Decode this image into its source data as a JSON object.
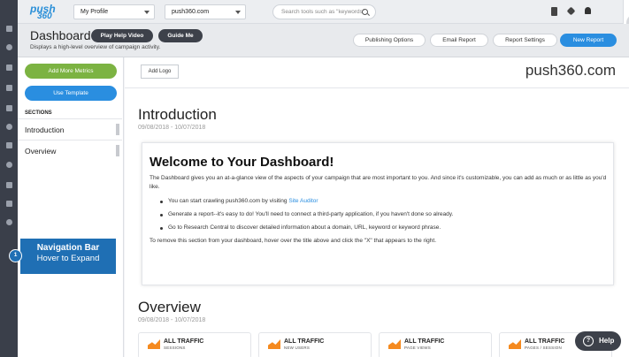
{
  "brand": {
    "logo_top": "push",
    "logo_bottom": "360"
  },
  "topbar": {
    "profile_select": "My Profile",
    "domain_select": "push360.com",
    "search_placeholder": "Search tools such as \"keywords\""
  },
  "header": {
    "title": "Dashboard",
    "subtitle": "Displays a high-level overview of campaign activity.",
    "play_help_video": "Play Help Video",
    "guide_me": "Guide Me",
    "publishing_options": "Publishing Options",
    "email_report": "Email Report",
    "report_settings": "Report Settings",
    "new_report": "New Report"
  },
  "sidebar": {
    "add_more_metrics": "Add More Metrics",
    "use_template": "Use Template",
    "sections_heading": "SECTIONS",
    "sections": [
      "Introduction",
      "Overview"
    ]
  },
  "callout": {
    "line1": "Navigation Bar",
    "line2": "Hover to Expand",
    "step_number": "1"
  },
  "main": {
    "add_logo": "Add Logo",
    "brand_name": "push360.com",
    "introduction": {
      "heading": "Introduction",
      "date_range": "09/08/2018 - 10/07/2018",
      "card_title": "Welcome to Your Dashboard!",
      "intro_text": "The Dashboard gives you an at-a-glance view of the aspects of your campaign that are most important to you. And since it's customizable, you can add as much or as little as you'd like.",
      "bullets": [
        {
          "text": "You can start crawling push360.com by visiting ",
          "link": "Site Auditor"
        },
        {
          "text": "Generate a report--it's easy to do! You'll need to connect a third-party application, if you haven't done so already.",
          "link": ""
        },
        {
          "text": "Go to Research Central to discover detailed information about a domain, URL, keyword or keyword phrase.",
          "link": ""
        }
      ],
      "remove_text": "To remove this section from your dashboard, hover over the title above and click the \"X\" that appears to the right."
    },
    "overview": {
      "heading": "Overview",
      "date_range": "09/08/2018 - 10/07/2018",
      "tiles": [
        {
          "title": "ALL TRAFFIC",
          "subtitle": "SESSIONS"
        },
        {
          "title": "ALL TRAFFIC",
          "subtitle": "NEW USERS"
        },
        {
          "title": "ALL TRAFFIC",
          "subtitle": "PAGE VIEWS"
        },
        {
          "title": "ALL TRAFFIC",
          "subtitle": "PAGES / SESSION"
        }
      ]
    }
  },
  "help_button": "Help",
  "colors": {
    "accent_blue": "#2a8ee0",
    "green": "#7cb342",
    "dark": "#3d414a",
    "chart_orange": "#f58a1f"
  }
}
